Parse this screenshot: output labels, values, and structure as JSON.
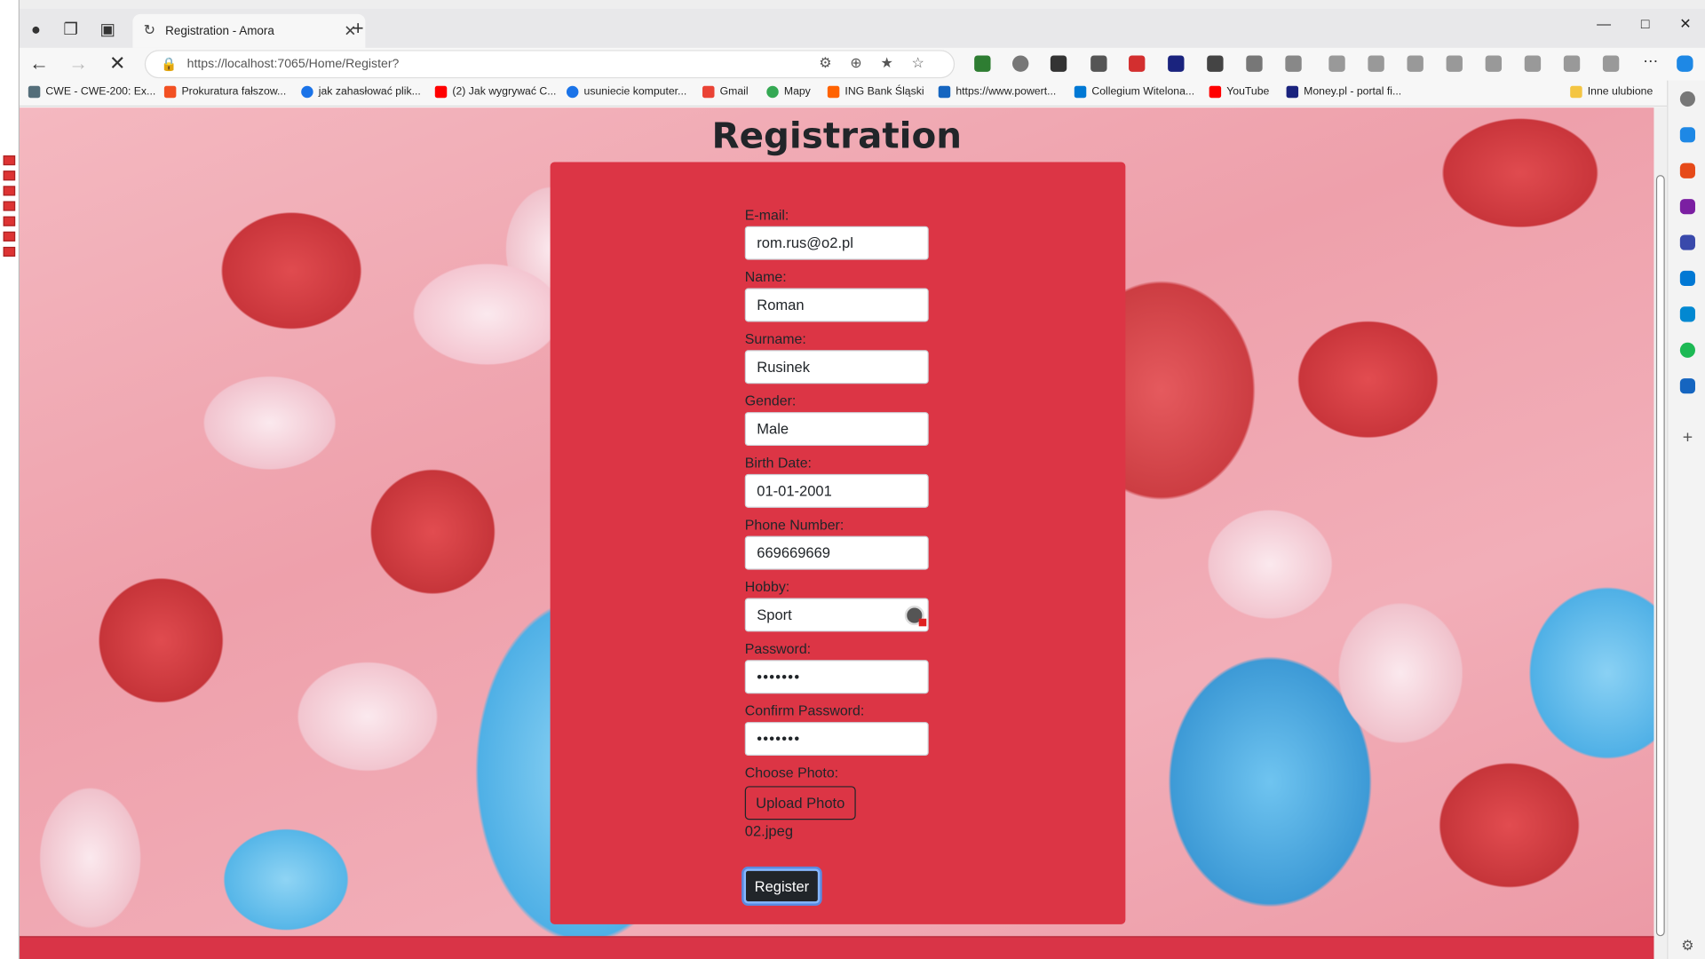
{
  "browser": {
    "tab_title": "Registration - Amora",
    "url": "https://localhost:7065/Home/Register?",
    "bookmarks": [
      "CWE - CWE-200: Ex...",
      "Prokuratura fałszow...",
      "jak zahasłować plik...",
      "(2) Jak wygrywać C...",
      "usuniecie komputer...",
      "Gmail",
      "Mapy",
      "ING Bank Śląski",
      "https://www.powert...",
      "Collegium Witelona...",
      "YouTube",
      "Money.pl - portal fi..."
    ],
    "other_bookmarks": "Inne ulubione"
  },
  "form": {
    "title": "Registration",
    "email_label": "E-mail:",
    "email_value": "rom.rus@o2.pl",
    "name_label": "Name:",
    "name_value": "Roman",
    "surname_label": "Surname:",
    "surname_value": "Rusinek",
    "gender_label": "Gender:",
    "gender_value": "Male",
    "birth_label": "Birth Date:",
    "birth_value": "01-01-2001",
    "phone_label": "Phone Number:",
    "phone_value": "669669669",
    "hobby_label": "Hobby:",
    "hobby_value": "Sport",
    "password_label": "Password:",
    "password_value": "•••••••",
    "confirm_label": "Confirm Password:",
    "confirm_value": "•••••••",
    "photo_label": "Choose Photo:",
    "upload_label": "Upload Photo",
    "file_name": "02.jpeg",
    "register_label": "Register"
  },
  "colors": {
    "card": "#dc3545",
    "button_dark": "#212529"
  }
}
